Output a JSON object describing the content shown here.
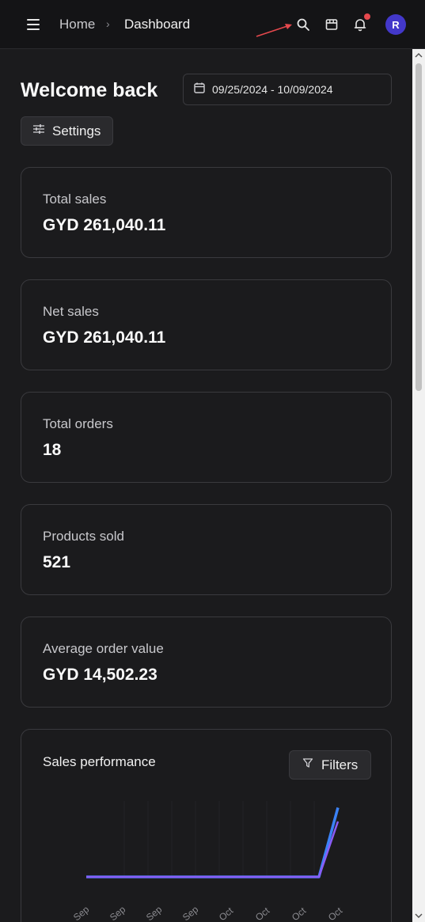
{
  "header": {
    "breadcrumb_home": "Home",
    "breadcrumb_separator": "›",
    "breadcrumb_current": "Dashboard",
    "avatar_initial": "R",
    "icons": [
      "menu-icon",
      "search-icon",
      "store-icon",
      "bell-icon"
    ]
  },
  "main": {
    "title": "Welcome back",
    "date_range": "09/25/2024 - 10/09/2024",
    "settings_label": "Settings"
  },
  "stats": [
    {
      "label": "Total sales",
      "value": "GYD 261,040.11"
    },
    {
      "label": "Net sales",
      "value": "GYD 261,040.11"
    },
    {
      "label": "Total orders",
      "value": "18"
    },
    {
      "label": "Products sold",
      "value": "521"
    },
    {
      "label": "Average order value",
      "value": "GYD 14,502.23"
    }
  ],
  "chart": {
    "title": "Sales performance",
    "filters_label": "Filters"
  },
  "chart_data": {
    "type": "line",
    "x": [
      "Sep",
      "Sep",
      "Sep",
      "Sep",
      "Oct",
      "Oct",
      "Oct",
      "Oct"
    ],
    "series": [
      {
        "color": "#3b82f6",
        "values": [
          0,
          0,
          0,
          0,
          0,
          0,
          0,
          0.35
        ]
      },
      {
        "color": "#8b5cf6",
        "values": [
          0,
          0,
          0,
          0,
          0,
          0,
          0,
          0.28
        ]
      }
    ]
  },
  "colors": {
    "background": "#1b1b1d",
    "topbar": "#141416",
    "accent": "#3b82f6",
    "avatar": "#4338ca",
    "notification": "#e5484d",
    "annotation_arrow": "#e5484d"
  }
}
